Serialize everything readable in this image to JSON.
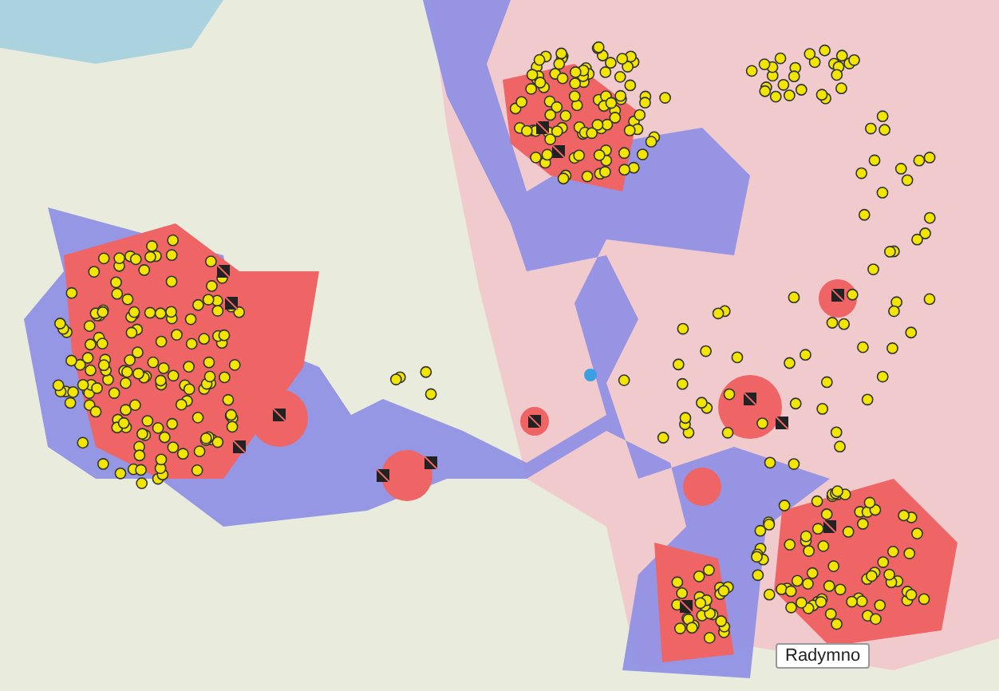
{
  "map_tooltip": {
    "label": "Radymno"
  }
}
